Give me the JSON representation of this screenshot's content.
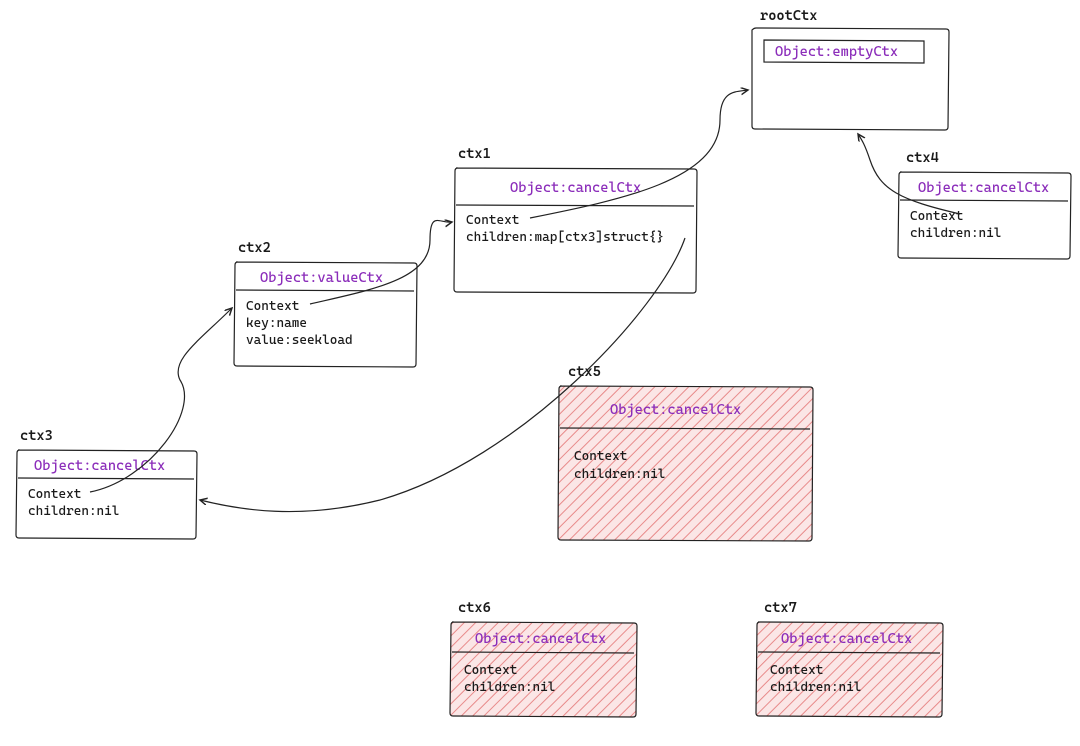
{
  "nodes": {
    "rootCtx": {
      "label": "rootCtx",
      "header": "Object:emptyCtx",
      "body": []
    },
    "ctx1": {
      "label": "ctx1",
      "header": "Object:cancelCtx",
      "body": [
        "Context",
        "children:map[ctx3]struct{}"
      ]
    },
    "ctx2": {
      "label": "ctx2",
      "header": "Object:valueCtx",
      "body": [
        "Context",
        "key:name",
        "value:seekload"
      ]
    },
    "ctx3": {
      "label": "ctx3",
      "header": "Object:cancelCtx",
      "body": [
        "Context",
        "children:nil"
      ]
    },
    "ctx4": {
      "label": "ctx4",
      "header": "Object:cancelCtx",
      "body": [
        "Context",
        "children:nil"
      ]
    },
    "ctx5": {
      "label": "ctx5",
      "header": "Object:cancelCtx",
      "body": [
        "Context",
        "children:nil"
      ],
      "highlight": true
    },
    "ctx6": {
      "label": "ctx6",
      "header": "Object:cancelCtx",
      "body": [
        "Context",
        "children:nil"
      ],
      "highlight": true
    },
    "ctx7": {
      "label": "ctx7",
      "header": "Object:cancelCtx",
      "body": [
        "Context",
        "children:nil"
      ],
      "highlight": true
    }
  },
  "edges": [
    {
      "from": "ctx3",
      "to": "ctx2"
    },
    {
      "from": "ctx2",
      "to": "ctx1"
    },
    {
      "from": "ctx1",
      "to": "rootCtx"
    },
    {
      "from": "ctx4",
      "to": "rootCtx"
    },
    {
      "from": "ctx1_children",
      "to": "ctx3"
    }
  ]
}
